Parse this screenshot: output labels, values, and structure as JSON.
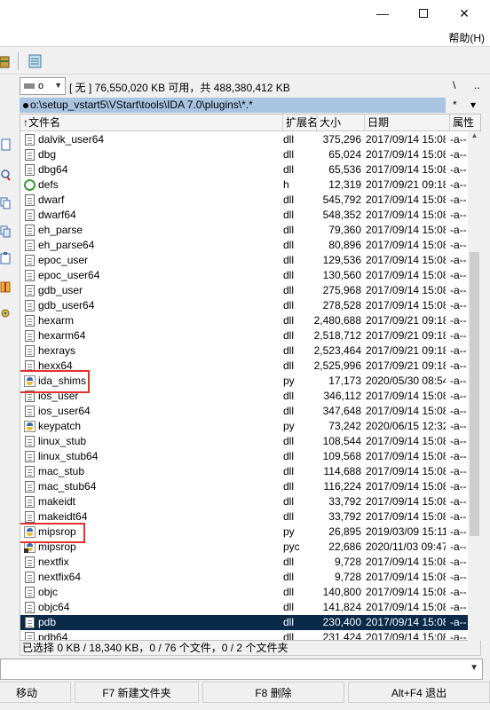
{
  "window": {
    "minimize_icon": "minimize-icon",
    "maximize_icon": "maximize-icon",
    "close_icon": "close-icon"
  },
  "menu": {
    "help": "帮助(H)"
  },
  "drive": {
    "letter": "o",
    "info": "[ 无 ]  76,550,020 KB 可用，共 488,380,412 KB",
    "right_a": "\\",
    "right_b": ".."
  },
  "path": {
    "value": "o:\\setup_vstart5\\VStart\\tools\\IDA 7.0\\plugins\\*.*",
    "right_a": "*",
    "right_b": "▾"
  },
  "columns": {
    "name": "↑文件名",
    "ext": "扩展名",
    "size": "大小",
    "date": "日期",
    "attr": "属性"
  },
  "files": [
    {
      "name": "dalvik_user64",
      "ext": "dll",
      "size": "375,296",
      "date": "2017/09/14 15:08",
      "attr": "-a--",
      "icon": "file"
    },
    {
      "name": "dbg",
      "ext": "dll",
      "size": "65,024",
      "date": "2017/09/14 15:08",
      "attr": "-a--",
      "icon": "file"
    },
    {
      "name": "dbg64",
      "ext": "dll",
      "size": "65,536",
      "date": "2017/09/14 15:08",
      "attr": "-a--",
      "icon": "file"
    },
    {
      "name": "defs",
      "ext": "h",
      "size": "12,319",
      "date": "2017/09/21 09:18",
      "attr": "-a--",
      "icon": "header"
    },
    {
      "name": "dwarf",
      "ext": "dll",
      "size": "545,792",
      "date": "2017/09/14 15:08",
      "attr": "-a--",
      "icon": "file"
    },
    {
      "name": "dwarf64",
      "ext": "dll",
      "size": "548,352",
      "date": "2017/09/14 15:08",
      "attr": "-a--",
      "icon": "file"
    },
    {
      "name": "eh_parse",
      "ext": "dll",
      "size": "79,360",
      "date": "2017/09/14 15:08",
      "attr": "-a--",
      "icon": "file"
    },
    {
      "name": "eh_parse64",
      "ext": "dll",
      "size": "80,896",
      "date": "2017/09/14 15:08",
      "attr": "-a--",
      "icon": "file"
    },
    {
      "name": "epoc_user",
      "ext": "dll",
      "size": "129,536",
      "date": "2017/09/14 15:08",
      "attr": "-a--",
      "icon": "file"
    },
    {
      "name": "epoc_user64",
      "ext": "dll",
      "size": "130,560",
      "date": "2017/09/14 15:08",
      "attr": "-a--",
      "icon": "file"
    },
    {
      "name": "gdb_user",
      "ext": "dll",
      "size": "275,968",
      "date": "2017/09/14 15:08",
      "attr": "-a--",
      "icon": "file"
    },
    {
      "name": "gdb_user64",
      "ext": "dll",
      "size": "278,528",
      "date": "2017/09/14 15:08",
      "attr": "-a--",
      "icon": "file"
    },
    {
      "name": "hexarm",
      "ext": "dll",
      "size": "2,480,688",
      "date": "2017/09/21 09:18",
      "attr": "-a--",
      "icon": "file"
    },
    {
      "name": "hexarm64",
      "ext": "dll",
      "size": "2,518,712",
      "date": "2017/09/21 09:18",
      "attr": "-a--",
      "icon": "file"
    },
    {
      "name": "hexrays",
      "ext": "dll",
      "size": "2,523,464",
      "date": "2017/09/21 09:18",
      "attr": "-a--",
      "icon": "file"
    },
    {
      "name": "hexx64",
      "ext": "dll",
      "size": "2,525,996",
      "date": "2017/09/21 09:18",
      "attr": "-a--",
      "icon": "file"
    },
    {
      "name": "ida_shims",
      "ext": "py",
      "size": "17,173",
      "date": "2020/05/30 08:54",
      "attr": "-a--",
      "icon": "python"
    },
    {
      "name": "ios_user",
      "ext": "dll",
      "size": "346,112",
      "date": "2017/09/14 15:08",
      "attr": "-a--",
      "icon": "file"
    },
    {
      "name": "ios_user64",
      "ext": "dll",
      "size": "347,648",
      "date": "2017/09/14 15:08",
      "attr": "-a--",
      "icon": "file"
    },
    {
      "name": "keypatch",
      "ext": "py",
      "size": "73,242",
      "date": "2020/06/15 12:32",
      "attr": "-a--",
      "icon": "python"
    },
    {
      "name": "linux_stub",
      "ext": "dll",
      "size": "108,544",
      "date": "2017/09/14 15:08",
      "attr": "-a--",
      "icon": "file"
    },
    {
      "name": "linux_stub64",
      "ext": "dll",
      "size": "109,568",
      "date": "2017/09/14 15:08",
      "attr": "-a--",
      "icon": "file"
    },
    {
      "name": "mac_stub",
      "ext": "dll",
      "size": "114,688",
      "date": "2017/09/14 15:08",
      "attr": "-a--",
      "icon": "file"
    },
    {
      "name": "mac_stub64",
      "ext": "dll",
      "size": "116,224",
      "date": "2017/09/14 15:08",
      "attr": "-a--",
      "icon": "file"
    },
    {
      "name": "makeidt",
      "ext": "dll",
      "size": "33,792",
      "date": "2017/09/14 15:08",
      "attr": "-a--",
      "icon": "file"
    },
    {
      "name": "makeidt64",
      "ext": "dll",
      "size": "33,792",
      "date": "2017/09/14 15:08",
      "attr": "-a--",
      "icon": "file"
    },
    {
      "name": "mipsrop",
      "ext": "py",
      "size": "26,895",
      "date": "2019/03/09 15:11",
      "attr": "-a--",
      "icon": "python"
    },
    {
      "name": "mipsrop",
      "ext": "pyc",
      "size": "22,686",
      "date": "2020/11/03 09:47",
      "attr": "-a--",
      "icon": "python-compiled"
    },
    {
      "name": "nextfix",
      "ext": "dll",
      "size": "9,728",
      "date": "2017/09/14 15:08",
      "attr": "-a--",
      "icon": "file"
    },
    {
      "name": "nextfix64",
      "ext": "dll",
      "size": "9,728",
      "date": "2017/09/14 15:08",
      "attr": "-a--",
      "icon": "file"
    },
    {
      "name": "objc",
      "ext": "dll",
      "size": "140,800",
      "date": "2017/09/14 15:08",
      "attr": "-a--",
      "icon": "file"
    },
    {
      "name": "objc64",
      "ext": "dll",
      "size": "141,824",
      "date": "2017/09/14 15:08",
      "attr": "-a--",
      "icon": "file"
    },
    {
      "name": "pdb",
      "ext": "dll",
      "size": "230,400",
      "date": "2017/09/14 15:08",
      "attr": "-a--",
      "icon": "file",
      "selected": true
    },
    {
      "name": "pdb64",
      "ext": "dll",
      "size": "231,424",
      "date": "2017/09/14 15:08",
      "attr": "-a--",
      "icon": "file"
    }
  ],
  "status": "已选择 0 KB / 18,340 KB，0 / 76 个文件，0 / 2 个文件夹",
  "fkeys": [
    "移动",
    "F7 新建文件夹",
    "F8 删除",
    "Alt+F4 退出"
  ],
  "colors": {
    "selection": "#0a2a4a",
    "path_bar": "#a8c4e0",
    "highlight_box": "#e53030"
  }
}
